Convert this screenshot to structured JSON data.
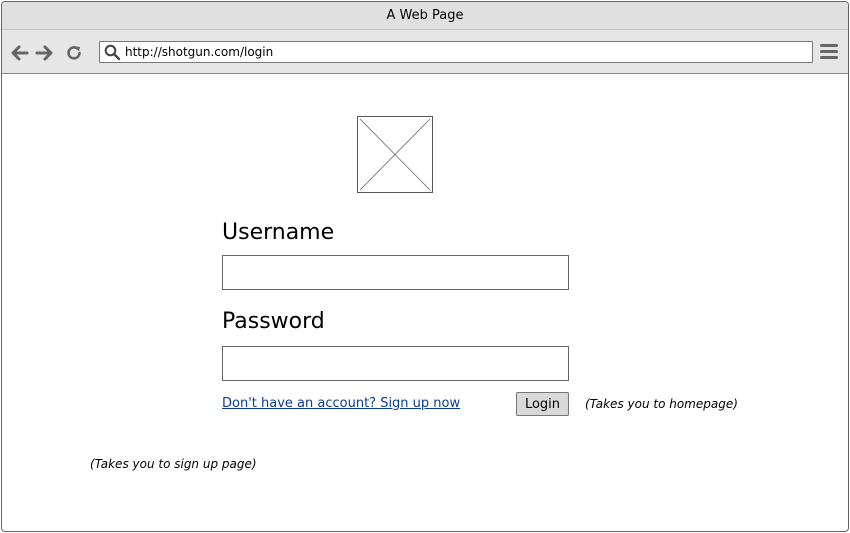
{
  "window": {
    "title": "A Web Page"
  },
  "toolbar": {
    "back_icon": "arrow-left-icon",
    "forward_icon": "arrow-right-icon",
    "reload_icon": "reload-icon",
    "address": {
      "url": "http://shotgun.com/login"
    },
    "menu_icon": "hamburger-menu-icon"
  },
  "login": {
    "username_label": "Username",
    "username_value": "",
    "password_label": "Password",
    "password_value": "",
    "signup_link": "Don't have an account? Sign up now",
    "login_button": "Login"
  },
  "annotations": {
    "login_note": "(Takes you to homepage)",
    "signup_note": "(Takes you to sign up page)"
  }
}
